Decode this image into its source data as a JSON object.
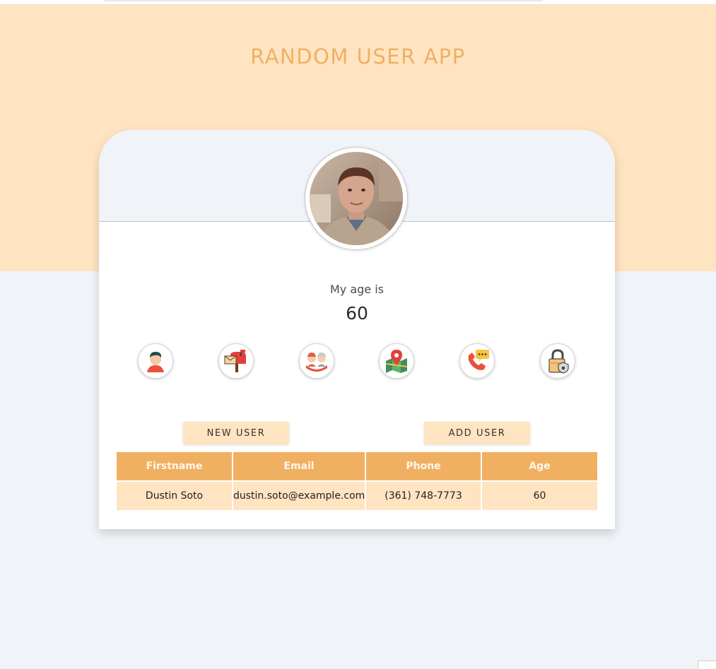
{
  "app": {
    "title": "RANDOM USER APP"
  },
  "profile": {
    "age_label": "My age is",
    "age_value": "60"
  },
  "icons": [
    {
      "name": "user-icon"
    },
    {
      "name": "mailbox-icon"
    },
    {
      "name": "age-group-icon"
    },
    {
      "name": "location-map-icon"
    },
    {
      "name": "phone-icon"
    },
    {
      "name": "lock-icon"
    }
  ],
  "actions": {
    "new_user": "NEW USER",
    "add_user": "ADD USER"
  },
  "table": {
    "headers": {
      "firstname": "Firstname",
      "email": "Email",
      "phone": "Phone",
      "age": "Age"
    },
    "rows": [
      {
        "firstname": "Dustin Soto",
        "email": "dustin.soto@example.com",
        "phone": "(361) 748-7773",
        "age": "60"
      }
    ]
  },
  "colors": {
    "accent": "#f0b062",
    "hero_background": "#ffe4c2",
    "page_background": "#f0f4f8"
  }
}
